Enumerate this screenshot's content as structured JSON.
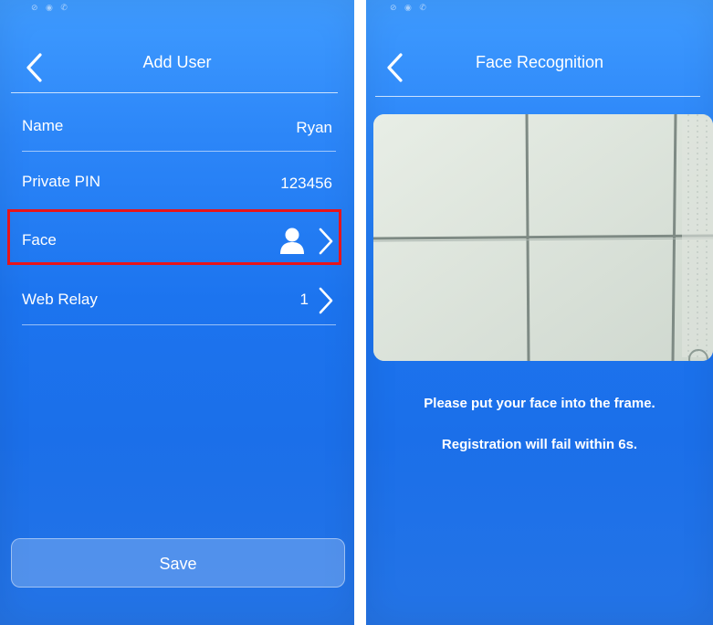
{
  "left_screen": {
    "title": "Add User",
    "rows": [
      {
        "label": "Name",
        "value": "Ryan"
      },
      {
        "label": "Private PIN",
        "value": "123456"
      },
      {
        "label": "Face",
        "icon": "person-icon"
      },
      {
        "label": "Web Relay",
        "value": "1"
      }
    ],
    "save_label": "Save",
    "highlight_color": "#e8141a"
  },
  "right_screen": {
    "title": "Face Recognition",
    "instruction_1": "Please put your face into the frame.",
    "instruction_2": "Registration will fail within 6s."
  }
}
